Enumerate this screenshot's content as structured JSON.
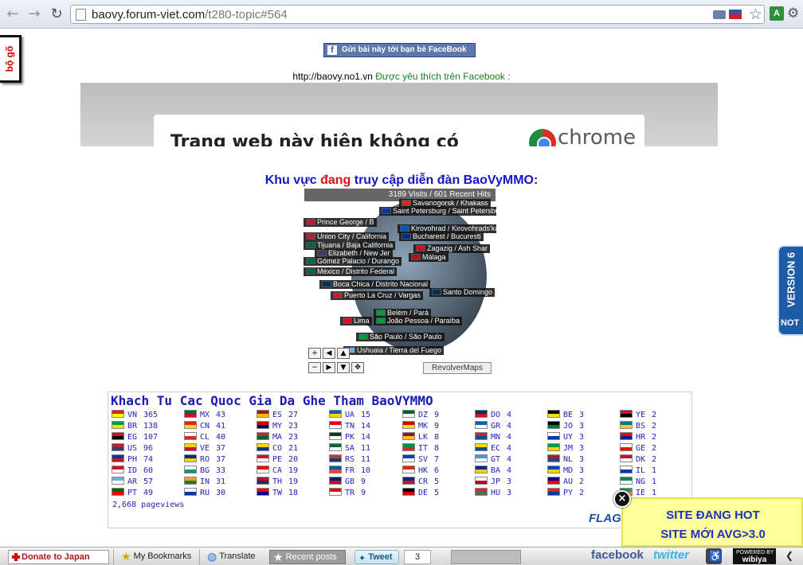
{
  "browser": {
    "url_domain": "baovy.forum-viet.com",
    "url_path": "/t280-topic#564"
  },
  "side": {
    "bogo_label": "bộ gõ",
    "version_label": "VERSION 6",
    "version_logo": "NOT"
  },
  "page": {
    "fb_share_label": "Gửi bài này tới bạn bè FaceBook",
    "fb_line_url": "http://baovy.no1.vn",
    "fb_line_text": "Được yêu thích trên Facebook :",
    "frame_message": "Trang web này hiện không có",
    "chrome_word": "chrome",
    "region_title_pre": "Khu vực",
    "region_title_hl": "đang",
    "region_title_post": "truy cập diễn đàn BaoVyMMO:"
  },
  "revolver": {
    "header": "3189 Visits / 601 Recent Hits",
    "brand": "RevolverMaps",
    "labels": [
      "Savanogorsk / Khakass",
      "Saint Petersburg / Saint Petersburg",
      "Prince George / B",
      "Kirovohrad / Kirovohrads'ka O",
      "Union City / California",
      "Bucharest / Bucuresti",
      "Tijuana / Baja California",
      "Elizabeth / New Jer",
      "Zagazig / Ash Shar",
      "Gómez Palacio / Durango",
      "Málaga",
      "México / Distrito Federal",
      "Boca Chica / Distrito Nacional",
      "Santo Domingo",
      "Puerto La Cruz / Vargas",
      "Belém / Pará",
      "Lima",
      "João Pessoa / Paraíba",
      "São Paulo / São Paulo",
      "Ushuaia / Tierra del Fuego"
    ]
  },
  "flags": {
    "title": "Khach Tu Cac Quoc Gia Da Ghe Tham BaoVYMMO",
    "columns": [
      [
        {
          "code": "VN",
          "count": "365",
          "colors": [
            "#da251d",
            "#ffff00"
          ]
        },
        {
          "code": "BR",
          "count": "138",
          "colors": [
            "#009b3a",
            "#fedf00"
          ]
        },
        {
          "code": "EG",
          "count": "107",
          "colors": [
            "#ce1126",
            "#000000"
          ]
        },
        {
          "code": "US",
          "count": "96",
          "colors": [
            "#b22234",
            "#3c3b6e"
          ]
        },
        {
          "code": "PH",
          "count": "74",
          "colors": [
            "#0038a8",
            "#ce1126"
          ]
        },
        {
          "code": "ID",
          "count": "60",
          "colors": [
            "#ce1126",
            "#ffffff"
          ]
        },
        {
          "code": "AR",
          "count": "57",
          "colors": [
            "#74acdf",
            "#ffffff"
          ]
        },
        {
          "code": "PT",
          "count": "49",
          "colors": [
            "#006600",
            "#ff0000"
          ]
        }
      ],
      [
        {
          "code": "MX",
          "count": "43",
          "colors": [
            "#006847",
            "#ce1126"
          ]
        },
        {
          "code": "CN",
          "count": "41",
          "colors": [
            "#de2910",
            "#ffde00"
          ]
        },
        {
          "code": "CL",
          "count": "40",
          "colors": [
            "#ffffff",
            "#d52b1e"
          ]
        },
        {
          "code": "VE",
          "count": "37",
          "colors": [
            "#ffcc00",
            "#cf142b"
          ]
        },
        {
          "code": "RO",
          "count": "37",
          "colors": [
            "#002b7f",
            "#fcd116"
          ]
        },
        {
          "code": "BG",
          "count": "33",
          "colors": [
            "#ffffff",
            "#00966e"
          ]
        },
        {
          "code": "IN",
          "count": "31",
          "colors": [
            "#ff9933",
            "#138808"
          ]
        },
        {
          "code": "RU",
          "count": "30",
          "colors": [
            "#ffffff",
            "#0039a6"
          ]
        }
      ],
      [
        {
          "code": "ES",
          "count": "27",
          "colors": [
            "#aa151b",
            "#f1bf00"
          ]
        },
        {
          "code": "MY",
          "count": "23",
          "colors": [
            "#cc0001",
            "#010066"
          ]
        },
        {
          "code": "MA",
          "count": "23",
          "colors": [
            "#c1272d",
            "#006233"
          ]
        },
        {
          "code": "CO",
          "count": "21",
          "colors": [
            "#fcd116",
            "#003893"
          ]
        },
        {
          "code": "PE",
          "count": "20",
          "colors": [
            "#d91023",
            "#ffffff"
          ]
        },
        {
          "code": "CA",
          "count": "19",
          "colors": [
            "#ff0000",
            "#ffffff"
          ]
        },
        {
          "code": "TH",
          "count": "19",
          "colors": [
            "#a51931",
            "#2d2a4a"
          ]
        },
        {
          "code": "TW",
          "count": "18",
          "colors": [
            "#fe0000",
            "#000095"
          ]
        }
      ],
      [
        {
          "code": "UA",
          "count": "15",
          "colors": [
            "#005bbb",
            "#ffd500"
          ]
        },
        {
          "code": "TN",
          "count": "14",
          "colors": [
            "#e70013",
            "#ffffff"
          ]
        },
        {
          "code": "PK",
          "count": "14",
          "colors": [
            "#01411c",
            "#ffffff"
          ]
        },
        {
          "code": "SA",
          "count": "11",
          "colors": [
            "#006c35",
            "#ffffff"
          ]
        },
        {
          "code": "RS",
          "count": "11",
          "colors": [
            "#c6363c",
            "#0c4076"
          ]
        },
        {
          "code": "FR",
          "count": "10",
          "colors": [
            "#0055a4",
            "#ef4135"
          ]
        },
        {
          "code": "GB",
          "count": "9",
          "colors": [
            "#012169",
            "#c8102e"
          ]
        },
        {
          "code": "TR",
          "count": "9",
          "colors": [
            "#e30a17",
            "#ffffff"
          ]
        }
      ],
      [
        {
          "code": "DZ",
          "count": "9",
          "colors": [
            "#006233",
            "#ffffff"
          ]
        },
        {
          "code": "MK",
          "count": "9",
          "colors": [
            "#d20000",
            "#ffe600"
          ]
        },
        {
          "code": "LK",
          "count": "8",
          "colors": [
            "#8d153a",
            "#ffbe29"
          ]
        },
        {
          "code": "IT",
          "count": "8",
          "colors": [
            "#009246",
            "#ce2b37"
          ]
        },
        {
          "code": "SV",
          "count": "7",
          "colors": [
            "#0047ab",
            "#ffffff"
          ]
        },
        {
          "code": "HK",
          "count": "6",
          "colors": [
            "#de2910",
            "#ffffff"
          ]
        },
        {
          "code": "CR",
          "count": "5",
          "colors": [
            "#002b7f",
            "#ce1126"
          ]
        },
        {
          "code": "DE",
          "count": "5",
          "colors": [
            "#000000",
            "#dd0000"
          ]
        }
      ],
      [
        {
          "code": "DO",
          "count": "4",
          "colors": [
            "#002d62",
            "#ce1126"
          ]
        },
        {
          "code": "GR",
          "count": "4",
          "colors": [
            "#0d5eaf",
            "#ffffff"
          ]
        },
        {
          "code": "MN",
          "count": "4",
          "colors": [
            "#c4272f",
            "#015197"
          ]
        },
        {
          "code": "EC",
          "count": "4",
          "colors": [
            "#ffdd00",
            "#034ea2"
          ]
        },
        {
          "code": "GT",
          "count": "4",
          "colors": [
            "#4997d0",
            "#ffffff"
          ]
        },
        {
          "code": "BA",
          "count": "4",
          "colors": [
            "#002395",
            "#fecb00"
          ]
        },
        {
          "code": "JP",
          "count": "3",
          "colors": [
            "#ffffff",
            "#bc002d"
          ]
        },
        {
          "code": "HU",
          "count": "3",
          "colors": [
            "#ce2939",
            "#477050"
          ]
        }
      ],
      [
        {
          "code": "BE",
          "count": "3",
          "colors": [
            "#000000",
            "#fdda24"
          ]
        },
        {
          "code": "JO",
          "count": "3",
          "colors": [
            "#000000",
            "#007a3d"
          ]
        },
        {
          "code": "UY",
          "count": "3",
          "colors": [
            "#ffffff",
            "#0038a8"
          ]
        },
        {
          "code": "JM",
          "count": "3",
          "colors": [
            "#009b3a",
            "#fed100"
          ]
        },
        {
          "code": "NL",
          "count": "3",
          "colors": [
            "#ae1c28",
            "#21468b"
          ]
        },
        {
          "code": "MD",
          "count": "3",
          "colors": [
            "#0046ae",
            "#ffd200"
          ]
        },
        {
          "code": "AU",
          "count": "2",
          "colors": [
            "#00008b",
            "#ff0000"
          ]
        },
        {
          "code": "PY",
          "count": "2",
          "colors": [
            "#d52b1e",
            "#0038a8"
          ]
        }
      ],
      [
        {
          "code": "YE",
          "count": "2",
          "colors": [
            "#ce1126",
            "#000000"
          ]
        },
        {
          "code": "BS",
          "count": "2",
          "colors": [
            "#00778b",
            "#ffc72c"
          ]
        },
        {
          "code": "HR",
          "count": "2",
          "colors": [
            "#ff0000",
            "#171796"
          ]
        },
        {
          "code": "GE",
          "count": "2",
          "colors": [
            "#ffffff",
            "#ff0000"
          ]
        },
        {
          "code": "DK",
          "count": "2",
          "colors": [
            "#c8102e",
            "#ffffff"
          ]
        },
        {
          "code": "IL",
          "count": "1",
          "colors": [
            "#ffffff",
            "#0038b8"
          ]
        },
        {
          "code": "NG",
          "count": "1",
          "colors": [
            "#008751",
            "#ffffff"
          ]
        },
        {
          "code": "IE",
          "count": "1",
          "colors": [
            "#169b62",
            "#ff883e"
          ]
        }
      ]
    ],
    "pageviews": "2,668 pageviews",
    "logo": "FLAG"
  },
  "promo": {
    "line1": "SITE ĐANG HOT",
    "line2": "SITE MỚI AVG>3.0",
    "close": "×"
  },
  "bottom_bar": {
    "donate": "Donate to Japan",
    "bookmarks": "My Bookmarks",
    "translate": "Translate",
    "recent": "Recent posts",
    "tweet": "Tweet",
    "tweet_count": "3",
    "facebook": "facebook",
    "twitter": "twitter",
    "wibiya_top": "POWERED BY",
    "wibiya_name": "wibiya"
  }
}
